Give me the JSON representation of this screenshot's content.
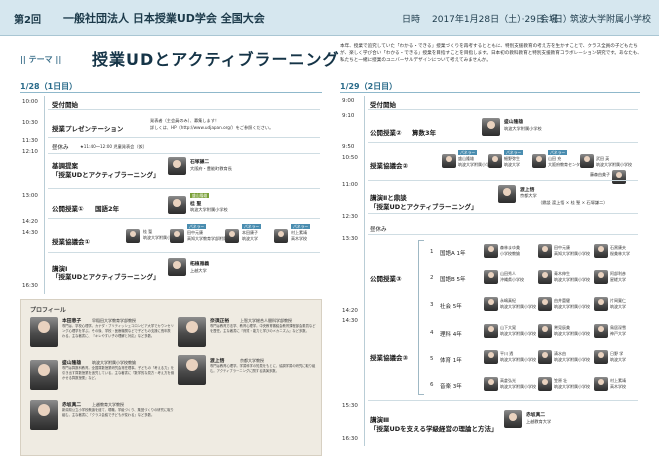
{
  "header": {
    "edition": "第2回",
    "title": "一般社団法人 日本授業UD学会 全国大会",
    "date_label": "日時",
    "date": "2017年1月28日（土）·29日（日）",
    "venue_label": "会場",
    "venue": "筑波大学附属小学校"
  },
  "theme": {
    "tag": "|| テーマ ||",
    "title": "授業UDとアクティブラーニング",
    "intro": "本年、授業で追究していた「わかる・できる」授業づくりを再考するとともに、特別支援教育の考え方を生かすことで、クラス全員の子どもたちが、楽しく学び合い「わかる・できる」授業を目指すことを目指します。日本初の教科教育と特別支援教育コラボレーション研究です。あなたも、私たちと一緒に授業のユニバーサルデザインについて考えてみませんか。"
  },
  "day1": {
    "heading": "1/28（1日目）",
    "times": [
      "10:00",
      "10:30",
      "11:30",
      "12:10",
      "13:00",
      "14:20",
      "14:30",
      "16:30"
    ],
    "slot_reception": "受付開始",
    "slot_presentation": "授業プレゼンテーション",
    "presentation_note1": "発表者（主会員のみ）、募集します！",
    "presentation_note2": "詳しくは、HP（http://www.udjapan.org/）をご参照ください。",
    "slot_break": "昼休み",
    "break_note": "★11:40〜12:00 児童発表会（仮）",
    "slot_keynote": "基調提案",
    "keynote_title": "「授業UDとアクティブラーニング」",
    "keynote_speaker": "石塚謙二",
    "keynote_speaker_org": "大阪府・豊能町教育長",
    "slot_lesson1": "公開授業①",
    "lesson1_subject": "国語2年",
    "lesson1_teacher": "桂 聖",
    "lesson1_teacher_org": "筑波大学附属小学校",
    "slot_discussion1": "授業協議会①",
    "panel_badge": "パネラー",
    "d1_panel": [
      {
        "name": "桂 聖",
        "org": "筑波大学附属小学校"
      },
      {
        "name": "田中元康",
        "org": "高知大学教育学部附属小学校"
      },
      {
        "name": "本田康子",
        "org": "筑波大学"
      },
      {
        "name": "村上素靖",
        "org": "高木学校"
      }
    ],
    "slot_lecture": "講演Ⅰ",
    "lecture_title": "「授業UDとアクティブラーニング」",
    "lecture_speaker": "柘植雅義",
    "lecture_speaker_org": "上越大学"
  },
  "profile": {
    "title": "プロフィール",
    "people": [
      {
        "name": "本田恵子",
        "role": "早稲田大学教育学部教授",
        "text": "専門は、学校心理学。カナダ・ブリティッシュコロンビア大学でカウンセリング心理学を学ぶ。その後、学校・医療機関などで子どもの支援に長年携わる。主な著書に、『キレやすい子の理解と対応』など多数。"
      },
      {
        "name": "盛山隆雄",
        "role": "筑波大学附属小学校教諭",
        "text": "専門は算数科教育。全国算数授業研究会常任理事。子どもの「考える力」を引き出す算数授業を追究している。主な著書に『数学的な見方・考え方を働かせる算数授業』など。"
      },
      {
        "name": "赤坂真二",
        "role": "上越教育大学教授",
        "text": "新潟県公立小学校教諭を経て、現職。学級づくり、集団づくりの研究に取り組む。主な著書に『クラス会議で子どもが変わる』など多数。"
      },
      {
        "name": "奈須正裕",
        "role": "上智大学総合人間科学部教授",
        "text": "専門は教育方法学、教育心理学。中央教育審議会教育課程部会委員などを歴任。主な著書に『資質・能力と学びのメカニズム』など多数。"
      },
      {
        "name": "渡上悟",
        "role": "京都大学教授",
        "text": "専門は教育心理学。学習科学の知見をもとに、協調学習の研究に取り組む。アクティブラーニングに関する講演多数。"
      }
    ]
  },
  "day2": {
    "heading": "1/29（2日目）",
    "times": [
      "9:00",
      "9:10",
      "9:50",
      "10:50",
      "11:00",
      "12:30",
      "13:30",
      "14:20",
      "14:30",
      "15:30",
      "16:30"
    ],
    "slot_reception": "受付開始",
    "slot_lesson2": "公開授業②",
    "lesson2_subject": "算数3年",
    "lesson2_teacher": "盛山隆雄",
    "lesson2_teacher_org": "筑波大学附属小学校",
    "slot_discussion2": "授業協議会②",
    "d2_panel": [
      {
        "name": "盛山隆雄",
        "org": "筑波大学附属小学校"
      },
      {
        "name": "細野弥生",
        "org": "筑波大学"
      },
      {
        "name": "山田 充",
        "org": "大阪府教育センター"
      },
      {
        "name": "武田 英",
        "org": "筑波大学附属小学校"
      },
      {
        "name": "藤森由美子",
        "org": "甲府大学"
      }
    ],
    "slot_lecture2": "講演Ⅱと鼎談",
    "lecture2_title": "「授業UDとアクティブラーニング」",
    "lecture2_speaker": "渡上悟",
    "lecture2_speaker_org": "京都大学",
    "lecture2_members": "（鼎談 渡上悟 × 桂 聖 × 石塚謙二）",
    "slot_break2": "昼休み",
    "slot_lesson3": "公開授業③",
    "slot_discussion3": "授業協議会③",
    "classes": [
      {
        "num": "1",
        "subject": "国語A 1年"
      },
      {
        "num": "2",
        "subject": "国語B 5年"
      },
      {
        "num": "3",
        "subject": "社会 5年"
      },
      {
        "num": "4",
        "subject": "理科 4年"
      },
      {
        "num": "5",
        "subject": "体育 1年"
      },
      {
        "num": "6",
        "subject": "音楽 3年"
      }
    ],
    "class_teachers": [
      {
        "name": "森林まゆ美",
        "org": "小学校教諭"
      },
      {
        "name": "山田秀人",
        "org": "沖縄県小学校"
      },
      {
        "name": "永嶋真紀",
        "org": "筑波大学附属小学校"
      },
      {
        "name": "山下大晃",
        "org": "筑波大学附属小学校"
      },
      {
        "name": "平川 透",
        "org": "筑波大学附属小学校"
      },
      {
        "name": "高倉弘光",
        "org": "筑波大学附属小学校"
      }
    ],
    "class_panel1": [
      {
        "name": "田中元康",
        "org": "高知大学附属小学校"
      },
      {
        "name": "青木伸生",
        "org": "筑波大学附属小学校"
      },
      {
        "name": "由井薗健",
        "org": "筑波大学附属小学校"
      },
      {
        "name": "鷲見辰美",
        "org": "筑波大学附属小学校"
      },
      {
        "name": "清水由",
        "org": "筑波大学附属小学校"
      },
      {
        "name": "笠原 壮",
        "org": "筑波大学附属小学校"
      }
    ],
    "class_panel2": [
      {
        "name": "石黒康夫",
        "org": "桜美林大学"
      },
      {
        "name": "阿部利彦",
        "org": "星槎大学"
      },
      {
        "name": "片岡寛仁",
        "org": "筑波大学"
      },
      {
        "name": "鳥居深雪",
        "org": "神戸大学"
      },
      {
        "name": "日野 学",
        "org": "筑波大学"
      },
      {
        "name": "村上素靖",
        "org": "高木学校"
      }
    ],
    "slot_lecture3": "講演Ⅲ",
    "lecture3_title": "「授業UDを支える学級経営の理論と方法」",
    "lecture3_speaker": "赤坂真二",
    "lecture3_speaker_org": "上越教育大学"
  }
}
